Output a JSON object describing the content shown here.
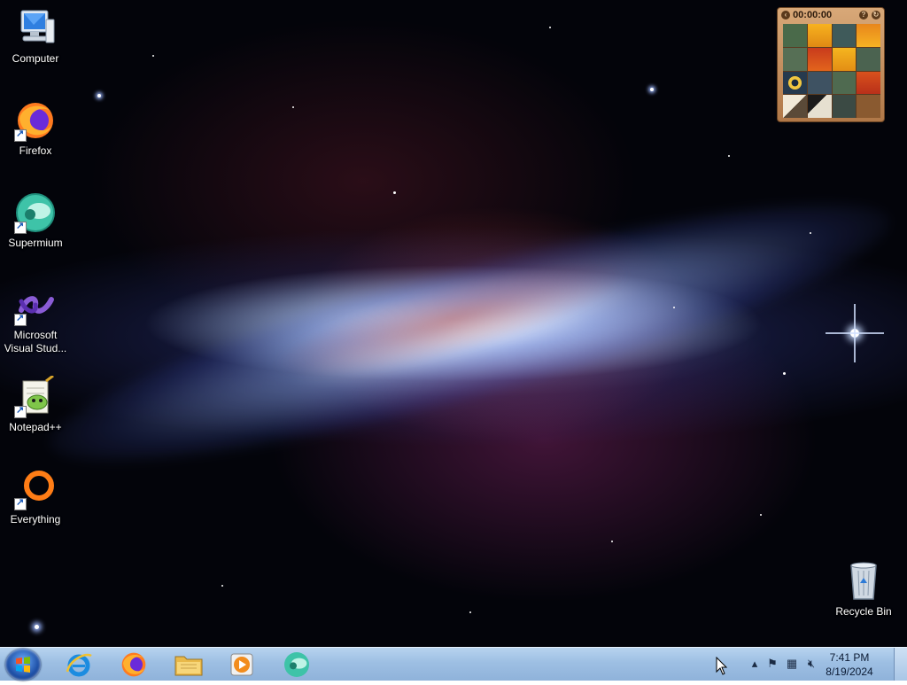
{
  "desktop": {
    "icons": [
      {
        "label": "Computer",
        "icon": "computer-icon",
        "shortcut": false
      },
      {
        "label": "Firefox",
        "icon": "firefox-icon",
        "shortcut": true
      },
      {
        "label": "Supermium",
        "icon": "supermium-icon",
        "shortcut": true
      },
      {
        "label": "Microsoft Visual Stud...",
        "icon": "visual-studio-icon",
        "shortcut": true
      },
      {
        "label": "Notepad++",
        "icon": "notepadpp-icon",
        "shortcut": true
      },
      {
        "label": "Everything",
        "icon": "everything-icon",
        "shortcut": true
      },
      {
        "label": "Recycle Bin",
        "icon": "recycle-bin-icon",
        "shortcut": false
      }
    ]
  },
  "gadget": {
    "name": "picture-puzzle",
    "timer": "00:00:00",
    "icons": [
      "back-icon",
      "help-icon",
      "refresh-icon"
    ]
  },
  "taskbar": {
    "start_icon": "windows-logo-icon",
    "pinned": [
      {
        "name": "internet-explorer",
        "icon": "internet-explorer-icon"
      },
      {
        "name": "firefox",
        "icon": "firefox-icon"
      },
      {
        "name": "file-explorer",
        "icon": "folder-icon"
      },
      {
        "name": "media-player",
        "icon": "media-player-icon"
      },
      {
        "name": "supermium",
        "icon": "supermium-icon"
      }
    ],
    "tray": {
      "icons": [
        "show-hidden-icons-icon",
        "action-center-flag-icon",
        "network-icon",
        "volume-muted-icon"
      ],
      "time": "7:41 PM",
      "date": "8/19/2024"
    }
  },
  "colors": {
    "taskbar_top": "#b7d3ef",
    "taskbar_bottom": "#8fb2da",
    "desktop_background": "#03040a",
    "gadget_frame": "#c48f5e"
  }
}
